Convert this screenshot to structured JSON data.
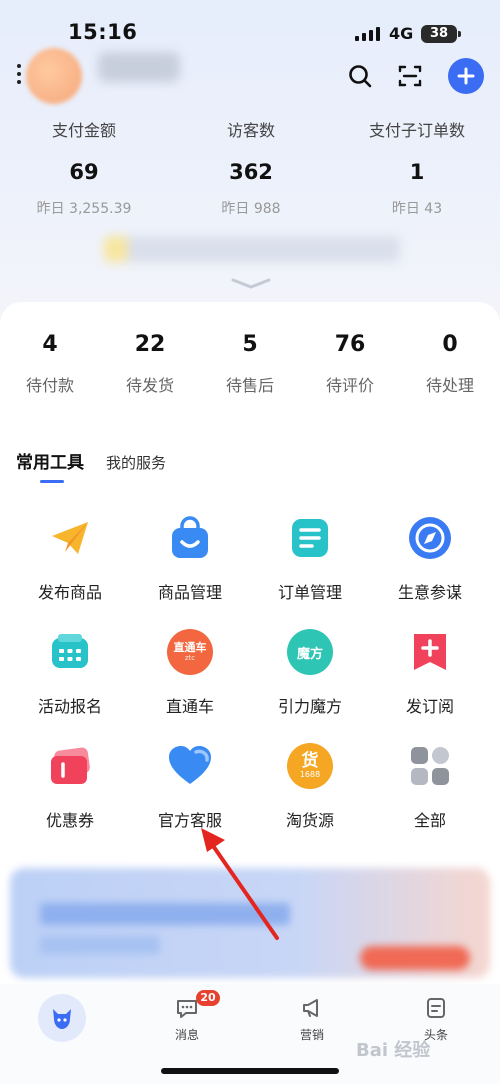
{
  "status_bar": {
    "time": "15:16",
    "network": "4G",
    "battery": "38"
  },
  "header": {
    "icons": [
      "menu-icon",
      "search-icon",
      "scan-icon",
      "add-icon"
    ]
  },
  "stats": [
    {
      "label": "支付金额",
      "value": "69",
      "prev": "昨日 3,255.39"
    },
    {
      "label": "访客数",
      "value": "362",
      "prev": "昨日 988"
    },
    {
      "label": "支付子订单数",
      "value": "1",
      "prev": "昨日 43"
    }
  ],
  "orders": [
    {
      "count": "4",
      "label": "待付款"
    },
    {
      "count": "22",
      "label": "待发货"
    },
    {
      "count": "5",
      "label": "待售后"
    },
    {
      "count": "76",
      "label": "待评价"
    },
    {
      "count": "0",
      "label": "待处理"
    }
  ],
  "tabs": {
    "active": "常用工具",
    "other": "我的服务"
  },
  "tools": [
    {
      "label": "发布商品",
      "icon": "publish-icon",
      "color": "#f7b52c"
    },
    {
      "label": "商品管理",
      "icon": "bag-icon",
      "color": "#3a8af4"
    },
    {
      "label": "订单管理",
      "icon": "order-list-icon",
      "color": "#27c3c9"
    },
    {
      "label": "生意参谋",
      "icon": "compass-icon",
      "color": "#3a7bf4"
    },
    {
      "label": "活动报名",
      "icon": "ticket-icon",
      "color": "#27c3c9"
    },
    {
      "label": "直通车",
      "icon": "ztc-icon",
      "color": "#f2673f",
      "logo_text": "直通车",
      "logo_sub": "ztc"
    },
    {
      "label": "引力魔方",
      "icon": "mofang-icon",
      "color": "#2ec5b5",
      "logo_text": "魔方"
    },
    {
      "label": "发订阅",
      "icon": "subscribe-icon",
      "color": "#f0425b"
    },
    {
      "label": "优惠券",
      "icon": "coupon-icon",
      "color": "#f0425b"
    },
    {
      "label": "官方客服",
      "icon": "heart-icon",
      "color": "#3a8af4"
    },
    {
      "label": "淘货源",
      "icon": "taohuoyuan-icon",
      "color": "#f5a623",
      "logo_text": "货",
      "logo_sub": "1688"
    },
    {
      "label": "全部",
      "icon": "all-icon",
      "color": "#9aa0aa"
    }
  ],
  "bottom_nav": {
    "items": [
      {
        "label": "",
        "icon": "home-icon"
      },
      {
        "label": "消息",
        "icon": "message-icon",
        "badge": "20"
      },
      {
        "label": "营销",
        "icon": "megaphone-icon"
      },
      {
        "label": "头条",
        "icon": "news-icon"
      }
    ]
  },
  "watermark": "Bai 经验"
}
